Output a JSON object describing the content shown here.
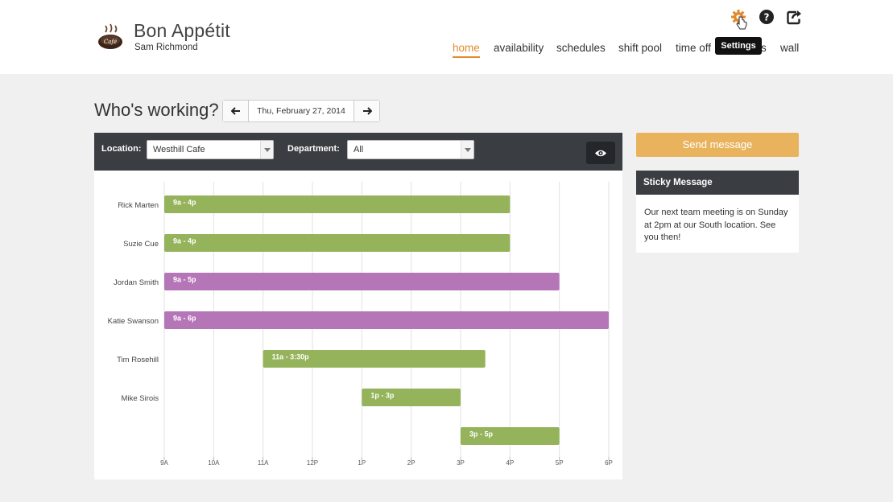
{
  "app": {
    "brand": "Bon Appétit",
    "logo_text": "Café",
    "user": "Sam Richmond"
  },
  "nav": {
    "items": [
      "home",
      "availability",
      "schedules",
      "shift pool",
      "time off",
      "s",
      "wall"
    ],
    "active": "home"
  },
  "top_icons": [
    "settings-gear",
    "help",
    "logout"
  ],
  "tooltip": "Settings",
  "colors": {
    "accent": "#e08a2c",
    "green_shift": "#95b35a",
    "purple_shift": "#b576b8",
    "dark_bar": "#3a3d42",
    "send_button": "#e9b35e"
  },
  "schedule": {
    "title": "Who's working?",
    "date": "Thu, February 27, 2014",
    "location_label": "Location:",
    "location_value": "Westhill Cafe",
    "department_label": "Department:",
    "department_value": "All"
  },
  "chart_data": {
    "type": "bar",
    "orientation": "horizontal-gantt",
    "x_ticks": [
      "9A",
      "10A",
      "11A",
      "12P",
      "1P",
      "2P",
      "3P",
      "4P",
      "5P",
      "6P"
    ],
    "xlim": [
      9,
      18
    ],
    "rows": [
      {
        "name": "Rick Marten",
        "label": "9a - 4p",
        "start": 9,
        "end": 16,
        "color": "#95b35a"
      },
      {
        "name": "Suzie Cue",
        "label": "9a - 4p",
        "start": 9,
        "end": 16,
        "color": "#95b35a"
      },
      {
        "name": "Jordan Smith",
        "label": "9a - 5p",
        "start": 9,
        "end": 17,
        "color": "#b576b8"
      },
      {
        "name": "Katie Swanson",
        "label": "9a - 6p",
        "start": 9,
        "end": 18,
        "color": "#b576b8"
      },
      {
        "name": "Tim Rosehill",
        "label": "11a - 3:30p",
        "start": 11,
        "end": 15.5,
        "color": "#95b35a"
      },
      {
        "name": "Mike Sirois",
        "label": "1p - 3p",
        "start": 13,
        "end": 15,
        "color": "#95b35a"
      },
      {
        "name": "",
        "label": "3p - 5p",
        "start": 15,
        "end": 17,
        "color": "#95b35a"
      }
    ]
  },
  "sidebar": {
    "send_label": "Send message",
    "sticky_title": "Sticky Message",
    "sticky_text": "Our next team meeting is on Sunday at 2pm at our South location. See you then!"
  }
}
